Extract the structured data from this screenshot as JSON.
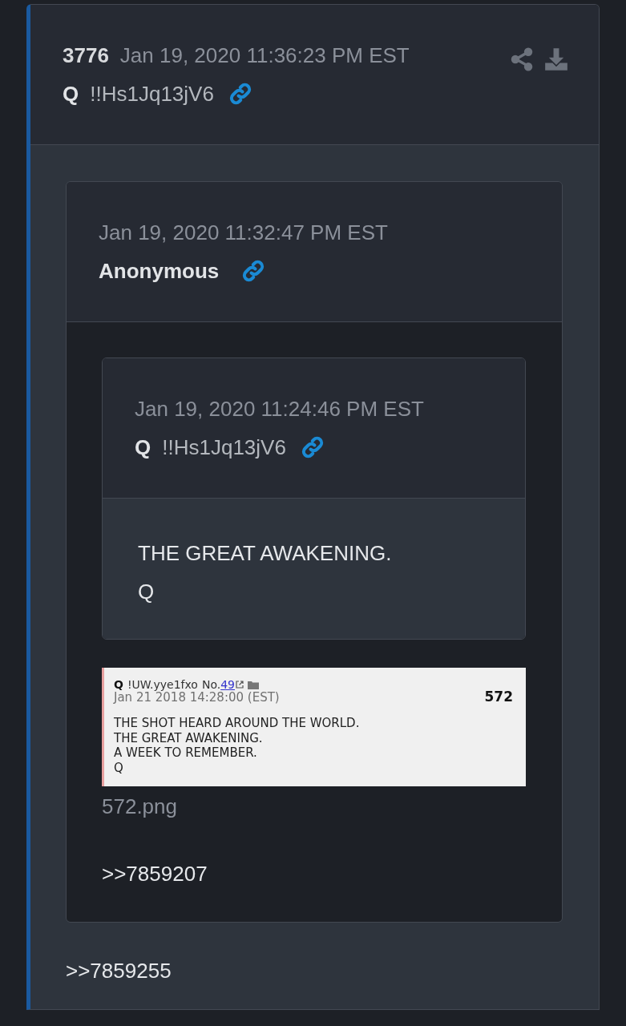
{
  "post": {
    "number": "3776",
    "date": "Jan 19, 2020 11:36:23 PM EST",
    "author": "Q",
    "tripcode": "!!Hs1Jq13jV6",
    "quote": {
      "date": "Jan 19, 2020 11:32:47 PM EST",
      "author": "Anonymous",
      "quote": {
        "date": "Jan 19, 2020 11:24:46 PM EST",
        "author": "Q",
        "tripcode": "!!Hs1Jq13jV6",
        "text": [
          "THE GREAT AWAKENING.",
          "Q"
        ]
      },
      "image": {
        "author": "Q",
        "tripcode": "!UW.yye1fxo",
        "post_label": "No.",
        "post_link": "49",
        "date": "Jan 21 2018 14:28:00 (EST)",
        "number": "572",
        "lines": [
          "THE SHOT HEARD AROUND THE WORLD.",
          "THE GREAT AWAKENING.",
          "A WEEK TO REMEMBER.",
          "Q"
        ]
      },
      "filename": "572.png",
      "text": [
        ">>7859207"
      ]
    },
    "text": [
      ">>7859255"
    ]
  }
}
